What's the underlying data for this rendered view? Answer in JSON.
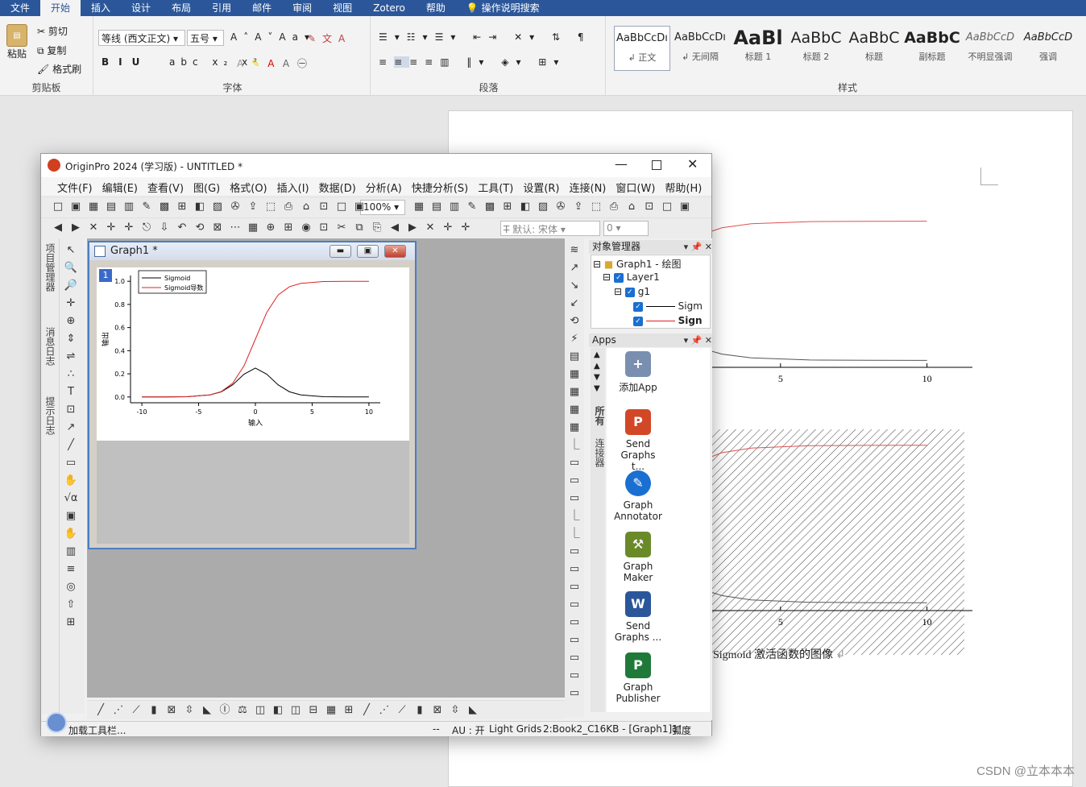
{
  "word": {
    "tabs": [
      "文件",
      "开始",
      "插入",
      "设计",
      "布局",
      "引用",
      "邮件",
      "审阅",
      "视图",
      "Zotero",
      "帮助"
    ],
    "active_tab": "开始",
    "tell_me": "操作说明搜索",
    "clipboard": {
      "paste": "粘贴",
      "cut": "剪切",
      "copy": "复制",
      "format_painter": "格式刷",
      "label": "剪贴板"
    },
    "font": {
      "name": "等线 (西文正文)",
      "size": "五号",
      "label": "字体"
    },
    "paragraph": {
      "label": "段落"
    },
    "styles": {
      "label": "样式",
      "items": [
        {
          "preview": "AaBbCcDı",
          "name": "↲ 正文"
        },
        {
          "preview": "AaBbCcDı",
          "name": "↲ 无间隔"
        },
        {
          "preview": "AaBl",
          "name": "标题 1"
        },
        {
          "preview": "AaBbC",
          "name": "标题 2"
        },
        {
          "preview": "AaBbC",
          "name": "标题"
        },
        {
          "preview": "AaBbC",
          "name": "副标题"
        },
        {
          "preview": "AaBbCcD",
          "name": "不明显强调"
        },
        {
          "preview": "AaBbCcD",
          "name": "强调"
        }
      ]
    },
    "caption": "Sigmoid 激活函数的图像",
    "watermark": "CSDN @立本本本"
  },
  "origin": {
    "title": "OriginPro 2024 (学习版) - UNTITLED *",
    "menu": [
      "文件(F)",
      "编辑(E)",
      "查看(V)",
      "图(G)",
      "格式(O)",
      "插入(I)",
      "数据(D)",
      "分析(A)",
      "快捷分析(S)",
      "工具(T)",
      "设置(R)",
      "连接(N)",
      "窗口(W)",
      "帮助(H)"
    ],
    "zoom": "100%",
    "font_combo": "默认: 宋体",
    "size_combo": "0",
    "left_tabs": [
      "项目管理器",
      "消息日志",
      "提示日志"
    ],
    "graph_window": {
      "title": "Graph1 *",
      "layer_number": "1"
    },
    "object_manager": {
      "title": "对象管理器",
      "tree": [
        "Graph1 - 绘图",
        "Layer1",
        "g1",
        "Sigm",
        "Sign"
      ]
    },
    "apps": {
      "title": "Apps",
      "side_tabs": [
        "所有",
        "连接器"
      ],
      "items": [
        {
          "label": "添加App",
          "icon": "add-app-icon",
          "color": "#7a8fb0"
        },
        {
          "label": "Send Graphs t...",
          "icon": "powerpoint-icon",
          "color": "#d24726"
        },
        {
          "label": "Graph Annotator",
          "icon": "annotator-icon",
          "color": "#1a6fd1"
        },
        {
          "label": "Graph Maker",
          "icon": "graph-maker-icon",
          "color": "#6a8a2a"
        },
        {
          "label": "Send Graphs ...",
          "icon": "word-icon",
          "color": "#2b579a"
        },
        {
          "label": "Graph Publisher",
          "icon": "publisher-icon",
          "color": "#1f7a3a"
        }
      ]
    },
    "status": [
      "加载工具栏...",
      "--",
      "AU : 开",
      "Light Grids",
      "2:Book2_C",
      "16KB - [Graph1]1!",
      "弧度"
    ]
  },
  "chart_data": [
    {
      "type": "line",
      "title": "",
      "xlabel": "输入",
      "ylabel": "输出",
      "xlim": [
        -11,
        11
      ],
      "ylim": [
        -0.05,
        1.05
      ],
      "xticks": [
        -10,
        -5,
        0,
        5,
        10
      ],
      "yticks": [
        0.0,
        0.2,
        0.4,
        0.6,
        0.8,
        1.0
      ],
      "legend": "top-left",
      "series": [
        {
          "name": "Sigmoid",
          "color": "#000000",
          "x": [
            -10,
            -8,
            -6,
            -4,
            -3,
            -2,
            -1,
            0,
            1,
            2,
            3,
            4,
            6,
            8,
            10
          ],
          "y": [
            5e-05,
            0.0003,
            0.0025,
            0.018,
            0.045,
            0.105,
            0.197,
            0.25,
            0.197,
            0.105,
            0.045,
            0.018,
            0.0025,
            0.0003,
            5e-05
          ]
        },
        {
          "name": "Sigmoid导数",
          "color": "#e02020",
          "x": [
            -10,
            -8,
            -6,
            -4,
            -3,
            -2,
            -1,
            0,
            1,
            2,
            3,
            4,
            6,
            8,
            10
          ],
          "y": [
            5e-05,
            0.0003,
            0.0025,
            0.018,
            0.047,
            0.119,
            0.269,
            0.5,
            0.731,
            0.881,
            0.953,
            0.982,
            0.9975,
            0.9997,
            0.99995
          ]
        }
      ]
    }
  ]
}
